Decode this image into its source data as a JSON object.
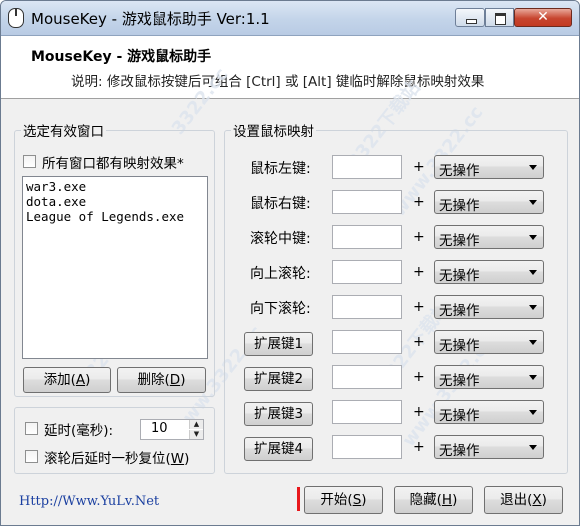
{
  "window": {
    "title": "MouseKey - 游戏鼠标助手 Ver:1.1",
    "controls": {
      "minimize": "minimize",
      "maximize": "maximize",
      "close": "✕"
    }
  },
  "header": {
    "title": "MouseKey - 游戏鼠标助手",
    "description": "说明: 修改鼠标按键后可组合 [Ctrl] 或 [Alt] 键临时解除鼠标映射效果"
  },
  "window_select": {
    "group_title": "选定有效窗口",
    "all_windows_checkbox": "所有窗口都有映射效果*",
    "all_windows_checked": false,
    "items": [
      "war3.exe",
      "dota.exe",
      "League of Legends.exe"
    ],
    "add_button": "添加(A)",
    "add_button_parts": [
      "添加(",
      "A",
      ")"
    ],
    "delete_button_parts": [
      "删除(",
      "D",
      ")"
    ]
  },
  "options": {
    "delay_label": "延时(毫秒):",
    "delay_checked": false,
    "delay_value": "10",
    "wheel_reset_parts": [
      "滚轮后延时一秒复位(",
      "W",
      ")"
    ],
    "wheel_reset_checked": false
  },
  "mapping": {
    "group_title": "设置鼠标映射",
    "plus": "+",
    "rows": [
      {
        "label": "鼠标左键:",
        "action": "无操作"
      },
      {
        "label": "鼠标右键:",
        "action": "无操作"
      },
      {
        "label": "滚轮中键:",
        "action": "无操作"
      },
      {
        "label": "向上滚轮:",
        "action": "无操作"
      },
      {
        "label": "向下滚轮:",
        "action": "无操作"
      },
      {
        "label": "扩展键1",
        "action": "无操作"
      },
      {
        "label": "扩展键2",
        "action": "无操作"
      },
      {
        "label": "扩展键3",
        "action": "无操作"
      },
      {
        "label": "扩展键4",
        "action": "无操作"
      }
    ]
  },
  "footer": {
    "url": "Http://Www.YuLv.Net",
    "start_parts": [
      "开始(",
      "S",
      ")"
    ],
    "hide_parts": [
      "隐藏(",
      "H",
      ")"
    ],
    "exit_parts": [
      "退出(",
      "X",
      ")"
    ],
    "accent_color": "#e8181c"
  },
  "watermark": [
    "3322.cc",
    "www.3322.cc",
    "3322下载站"
  ]
}
